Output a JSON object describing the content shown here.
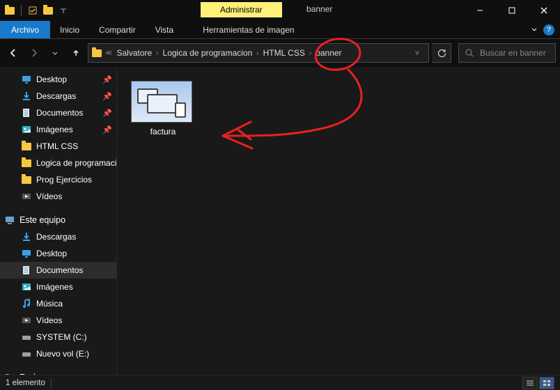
{
  "window": {
    "title": "banner",
    "context_tab": "Administrar"
  },
  "ribbon": {
    "file": "Archivo",
    "tabs": [
      "Inicio",
      "Compartir",
      "Vista"
    ],
    "context": "Herramientas de imagen"
  },
  "breadcrumb": [
    "Salvatore",
    "Logica de programacion",
    "HTML CSS",
    "banner"
  ],
  "search": {
    "placeholder": "Buscar en banner"
  },
  "sidebar": {
    "quick": {
      "header": "",
      "items": [
        {
          "label": "Desktop",
          "pinned": true,
          "icon": "desktop"
        },
        {
          "label": "Descargas",
          "pinned": true,
          "icon": "download"
        },
        {
          "label": "Documentos",
          "pinned": true,
          "icon": "doc"
        },
        {
          "label": "Imágenes",
          "pinned": true,
          "icon": "images"
        },
        {
          "label": "HTML CSS",
          "pinned": false,
          "icon": "folder"
        },
        {
          "label": "Logica de programacion",
          "pinned": false,
          "icon": "folder"
        },
        {
          "label": "Prog Ejercicios",
          "pinned": false,
          "icon": "folder"
        },
        {
          "label": "Vídeos",
          "pinned": false,
          "icon": "video"
        }
      ]
    },
    "thispc": {
      "header": "Este equipo",
      "items": [
        {
          "label": "Descargas",
          "icon": "download"
        },
        {
          "label": "Desktop",
          "icon": "desktop"
        },
        {
          "label": "Documentos",
          "icon": "doc",
          "selected": true
        },
        {
          "label": "Imágenes",
          "icon": "images"
        },
        {
          "label": "Música",
          "icon": "music"
        },
        {
          "label": "Vídeos",
          "icon": "video"
        },
        {
          "label": "SYSTEM (C:)",
          "icon": "drive"
        },
        {
          "label": "Nuevo vol (E:)",
          "icon": "drive"
        }
      ]
    },
    "network": {
      "header": "Red"
    }
  },
  "files": [
    {
      "name": "factura"
    }
  ],
  "status": {
    "count": "1 elemento"
  }
}
